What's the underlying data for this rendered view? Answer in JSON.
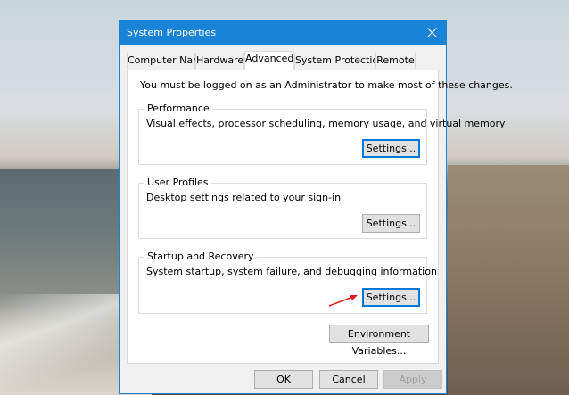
{
  "window": {
    "title": "System Properties"
  },
  "tabs": [
    {
      "label": "Computer Name"
    },
    {
      "label": "Hardware"
    },
    {
      "label": "Advanced"
    },
    {
      "label": "System Protection"
    },
    {
      "label": "Remote"
    }
  ],
  "active_tab": "Advanced",
  "notice": "You must be logged on as an Administrator to make most of these changes.",
  "performance": {
    "title": "Performance",
    "description": "Visual effects, processor scheduling, memory usage, and virtual memory",
    "button": "Settings..."
  },
  "user_profiles": {
    "title": "User Profiles",
    "description": "Desktop settings related to your sign-in",
    "button": "Settings..."
  },
  "startup_recovery": {
    "title": "Startup and Recovery",
    "description": "System startup, system failure, and debugging information",
    "button": "Settings..."
  },
  "environment_button": "Environment Variables...",
  "footer": {
    "ok": "OK",
    "cancel": "Cancel",
    "apply": "Apply"
  },
  "colors": {
    "titlebar": "#1883d7",
    "arrow": "#e01e1e"
  },
  "icons": {
    "close": "close-icon",
    "annotation": "red-arrow-icon"
  }
}
